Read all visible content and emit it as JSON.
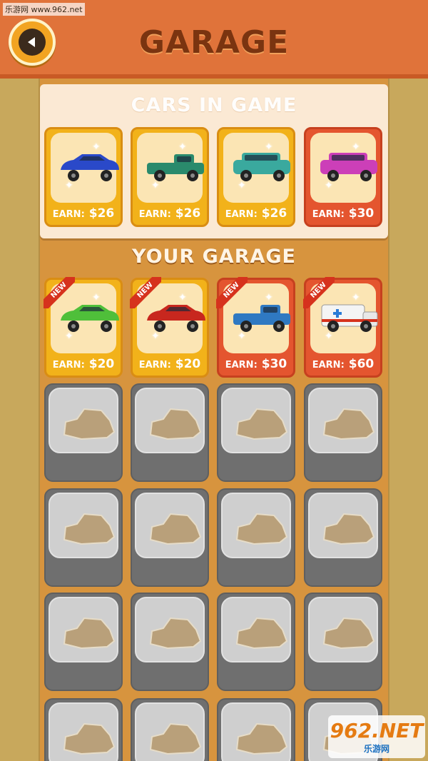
{
  "watermark_top": "乐游网 www.962.net",
  "header": {
    "title": "GARAGE",
    "back_icon": "back-arrow-icon"
  },
  "cars_in_game": {
    "title": "CARS IN GAME",
    "cards": [
      {
        "earn_label": "EARN:",
        "amount": "$26",
        "car": "blue-sports-car",
        "color": "#2a49c9",
        "style": "gold"
      },
      {
        "earn_label": "EARN:",
        "amount": "$26",
        "car": "green-pickup-truck",
        "color": "#2a8a6c",
        "style": "gold"
      },
      {
        "earn_label": "EARN:",
        "amount": "$26",
        "car": "teal-suv",
        "color": "#3aa99e",
        "style": "gold"
      },
      {
        "earn_label": "EARN:",
        "amount": "$30",
        "car": "pink-suv",
        "color": "#cc3fb8",
        "style": "red"
      }
    ]
  },
  "your_garage": {
    "title": "YOUR GARAGE",
    "cards": [
      {
        "badge": "NEW",
        "earn_label": "EARN:",
        "amount": "$20",
        "car": "green-sports-car",
        "color": "#4fbf3a",
        "style": "gold"
      },
      {
        "badge": "NEW",
        "earn_label": "EARN:",
        "amount": "$20",
        "car": "red-muscle-car",
        "color": "#c8271e",
        "style": "gold"
      },
      {
        "badge": "NEW",
        "earn_label": "EARN:",
        "amount": "$30",
        "car": "blue-pickup-truck",
        "color": "#2f79c2",
        "style": "red"
      },
      {
        "badge": "NEW",
        "earn_label": "EARN:",
        "amount": "$60",
        "car": "ambulance",
        "color": "#f2f2f2",
        "style": "red"
      }
    ],
    "empty_slots": 16
  },
  "watermark_bottom": {
    "logo": "962.NET",
    "text": "乐游网"
  }
}
